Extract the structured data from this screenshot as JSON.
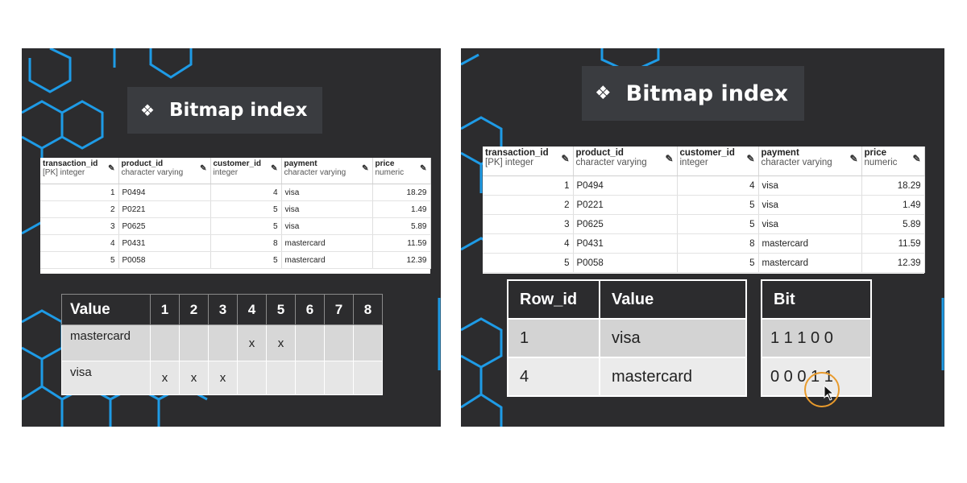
{
  "slide_title": "Bitmap index",
  "title_icon": "diamond-cluster-icon",
  "colors": {
    "panel_bg": "#2c2c2e",
    "hex_line": "#1e9be6",
    "cursor_ring": "#e89a2c"
  },
  "db_table": {
    "columns": [
      {
        "name": "transaction_id",
        "type": "[PK] integer"
      },
      {
        "name": "product_id",
        "type": "character varying"
      },
      {
        "name": "customer_id",
        "type": "integer"
      },
      {
        "name": "payment",
        "type": "character varying"
      },
      {
        "name": "price",
        "type": "numeric"
      }
    ],
    "rows": [
      [
        "1",
        "P0494",
        "4",
        "visa",
        "18.29"
      ],
      [
        "2",
        "P0221",
        "5",
        "visa",
        "1.49"
      ],
      [
        "3",
        "P0625",
        "5",
        "visa",
        "5.89"
      ],
      [
        "4",
        "P0431",
        "8",
        "mastercard",
        "11.59"
      ],
      [
        "5",
        "P0058",
        "5",
        "mastercard",
        "12.39"
      ]
    ]
  },
  "bitmap_table": {
    "header": [
      "Value",
      "1",
      "2",
      "3",
      "4",
      "5",
      "6",
      "7",
      "8"
    ],
    "rows": [
      [
        "mastercard",
        "",
        "",
        "",
        "x",
        "x",
        "",
        "",
        ""
      ],
      [
        "visa",
        "x",
        "x",
        "x",
        "",
        "",
        "",
        "",
        ""
      ]
    ]
  },
  "row_value_table": {
    "header": [
      "Row_id",
      "Value"
    ],
    "rows": [
      [
        "1",
        "visa"
      ],
      [
        "4",
        "mastercard"
      ]
    ]
  },
  "bit_table": {
    "header": "Bit",
    "rows": [
      "1 1 1 0 0",
      "0 0 0 1 1"
    ]
  }
}
